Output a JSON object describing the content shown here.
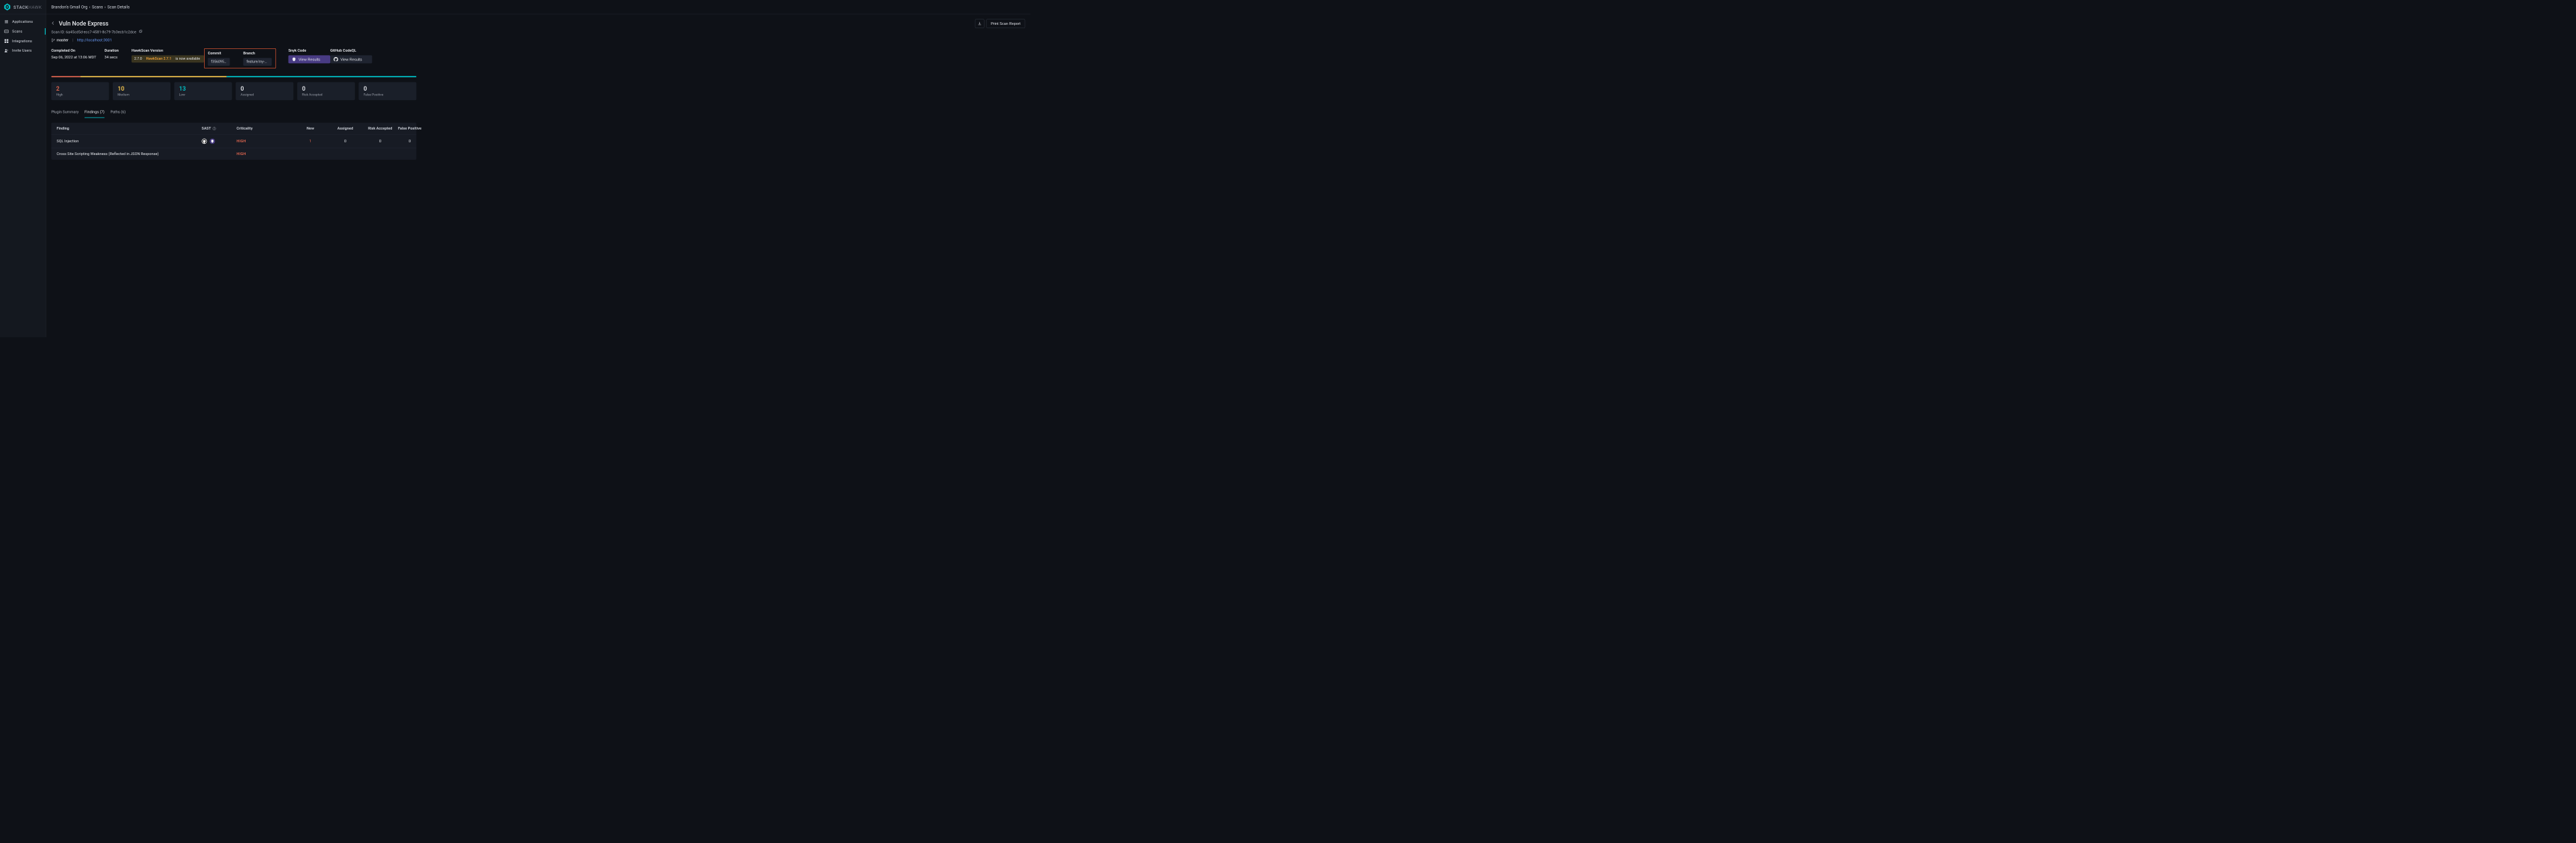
{
  "brand": {
    "primary": "STACK",
    "secondary": "HAWK"
  },
  "sidebar": {
    "items": [
      {
        "label": "Applications",
        "icon": "applications"
      },
      {
        "label": "Scans",
        "icon": "scans"
      },
      {
        "label": "Integrations",
        "icon": "integrations"
      },
      {
        "label": "Invite Users",
        "icon": "invite-users"
      }
    ]
  },
  "breadcrumb": {
    "org": "Brandon's Gmail Org",
    "mid": "Scans",
    "current": "Scan Details"
  },
  "header": {
    "title": "Vuln Node Express",
    "download_label": "",
    "print_label": "Print Scan Report",
    "scan_id_prefix": "Scan ID:",
    "scan_id": "6a45cd5d-ecc7-4581-8c79-7b3ecb1c2dce"
  },
  "meta": {
    "branch_main": "master",
    "separator": "|",
    "url": "http://localhost:3001"
  },
  "info": {
    "completed_label": "Completed On",
    "completed_value": "Sep 06, 2022 at 13:06 MDT",
    "duration_label": "Duration",
    "duration_value": "34 secs",
    "hawkscan_label": "HawkScan Version",
    "hawkscan_version": "2.7.0",
    "hawkscan_banner_prefix": "HawkScan",
    "hawkscan_banner_ver": "2.7.1",
    "hawkscan_banner_suffix": "is now available",
    "commit_label": "Commit",
    "commit_value": "f356095…",
    "branch_label": "Branch",
    "branch_value": "feature/my-se…",
    "snyk_label": "Snyk Code",
    "ghcodeql_label": "GitHub CodeQL",
    "view_results": "View Results"
  },
  "stats": [
    {
      "value": "2",
      "label": "High",
      "variant": "high"
    },
    {
      "value": "10",
      "label": "Medium",
      "variant": "medium"
    },
    {
      "value": "13",
      "label": "Low",
      "variant": "low"
    },
    {
      "value": "0",
      "label": "Assigned",
      "variant": "muted"
    },
    {
      "value": "0",
      "label": "Risk Accepted",
      "variant": "muted"
    },
    {
      "value": "0",
      "label": "False Positive",
      "variant": "muted"
    }
  ],
  "tabs": [
    {
      "label": "Plugin Summary"
    },
    {
      "label": "Findings (7)"
    },
    {
      "label": "Paths (6)"
    }
  ],
  "table": {
    "headers": {
      "finding": "Finding",
      "sast": "SAST",
      "criticality": "Criticality",
      "new": "New",
      "assigned": "Assigned",
      "risk_accepted": "Risk Accepted",
      "false_positive": "False Positive"
    },
    "rows": [
      {
        "finding": "SQL Injection",
        "criticality": "HIGH",
        "new": "1",
        "assigned": "0",
        "risk_accepted": "0",
        "false_positive": "0",
        "show_sast": true
      },
      {
        "finding": "Cross Site Scripting Weakness (Reflected in JSON Response)",
        "criticality": "HIGH",
        "new": "",
        "assigned": "",
        "risk_accepted": "",
        "false_positive": "",
        "show_sast": false
      }
    ]
  }
}
